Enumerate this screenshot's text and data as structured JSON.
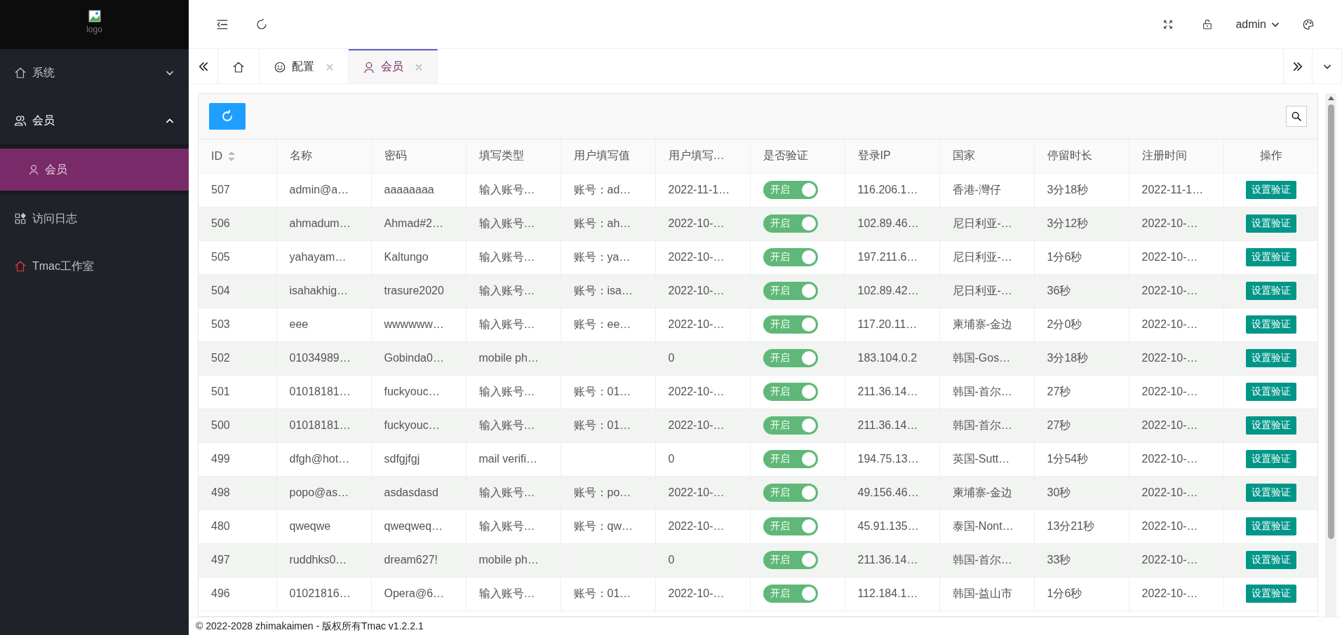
{
  "logo": {
    "alt": "logo"
  },
  "sidebar": {
    "items": [
      {
        "label": "系统",
        "expanded": false,
        "selected": false
      },
      {
        "label": "会员",
        "expanded": true,
        "selected": false,
        "children": [
          {
            "label": "会员",
            "selected": true
          }
        ]
      },
      {
        "label": "访问日志",
        "selected": false
      },
      {
        "label": "Tmac工作室",
        "selected": false
      }
    ]
  },
  "header": {
    "user": "admin"
  },
  "tabs": [
    {
      "kind": "home",
      "selected": false
    },
    {
      "kind": "page",
      "label": "配置",
      "selected": false
    },
    {
      "kind": "page",
      "label": "会员",
      "selected": true
    }
  ],
  "table": {
    "columns": [
      {
        "label": "ID"
      },
      {
        "label": "名称"
      },
      {
        "label": "密码"
      },
      {
        "label": "填写类型"
      },
      {
        "label": "用户填写值"
      },
      {
        "label": "用户填写…"
      },
      {
        "label": "是否验证"
      },
      {
        "label": "登录IP"
      },
      {
        "label": "国家"
      },
      {
        "label": "停留时长"
      },
      {
        "label": "注册时间"
      },
      {
        "label": "操作"
      }
    ],
    "rows": [
      {
        "id": "507",
        "name": "admin@a…",
        "password": "aaaaaaaa",
        "fill_type": "输入账号…",
        "fill_value": "账号：ad…",
        "column_6": "2022-11-1…",
        "verify": {
          "label": "开启",
          "on": true
        },
        "login_ip": "116.206.1…",
        "country": "香港-灣仔",
        "stay_time": "3分18秒",
        "register_time": "2022-11-1…",
        "action": "设置验证"
      },
      {
        "id": "506",
        "name": "ahmadum…",
        "password": "Ahmad#2…",
        "fill_type": "输入账号…",
        "fill_value": "账号：ah…",
        "column_6": "2022-10-…",
        "verify": {
          "label": "开启",
          "on": true
        },
        "login_ip": "102.89.46…",
        "country": "尼日利亚-…",
        "stay_time": "3分12秒",
        "register_time": "2022-10-…",
        "action": "设置验证"
      },
      {
        "id": "505",
        "name": "yahayam…",
        "password": "Kaltungo",
        "fill_type": "输入账号…",
        "fill_value": "账号：ya…",
        "column_6": "2022-10-…",
        "verify": {
          "label": "开启",
          "on": true
        },
        "login_ip": "197.211.6…",
        "country": "尼日利亚-…",
        "stay_time": "1分6秒",
        "register_time": "2022-10-…",
        "action": "设置验证"
      },
      {
        "id": "504",
        "name": "isahakhig…",
        "password": "trasure2020",
        "fill_type": "输入账号…",
        "fill_value": "账号：isa…",
        "column_6": "2022-10-…",
        "verify": {
          "label": "开启",
          "on": true
        },
        "login_ip": "102.89.42…",
        "country": "尼日利亚-…",
        "stay_time": "36秒",
        "register_time": "2022-10-…",
        "action": "设置验证"
      },
      {
        "id": "503",
        "name": "eee",
        "password": "wwwwww…",
        "fill_type": "输入账号…",
        "fill_value": "账号：ee…",
        "column_6": "2022-10-…",
        "verify": {
          "label": "开启",
          "on": true
        },
        "login_ip": "117.20.11…",
        "country": "柬埔寨-金边",
        "stay_time": "2分0秒",
        "register_time": "2022-10-…",
        "action": "设置验证"
      },
      {
        "id": "502",
        "name": "01034989…",
        "password": "Gobinda0…",
        "fill_type": "mobile ph…",
        "column_6": "0",
        "verify": {
          "label": "开启",
          "on": true
        },
        "login_ip": "183.104.0.2",
        "country": "韩国-Gos…",
        "stay_time": "3分18秒",
        "register_time": "2022-10-…",
        "action": "设置验证"
      },
      {
        "id": "501",
        "name": "01018181…",
        "password": "fuckyouc…",
        "fill_type": "输入账号…",
        "fill_value": "账号：01…",
        "column_6": "2022-10-…",
        "verify": {
          "label": "开启",
          "on": true
        },
        "login_ip": "211.36.14…",
        "country": "韩国-首尔…",
        "stay_time": "27秒",
        "register_time": "2022-10-…",
        "action": "设置验证"
      },
      {
        "id": "500",
        "name": "01018181…",
        "password": "fuckyouc…",
        "fill_type": "输入账号…",
        "fill_value": "账号：01…",
        "column_6": "2022-10-…",
        "verify": {
          "label": "开启",
          "on": true
        },
        "login_ip": "211.36.14…",
        "country": "韩国-首尔…",
        "stay_time": "27秒",
        "register_time": "2022-10-…",
        "action": "设置验证"
      },
      {
        "id": "499",
        "name": "dfgh@hot…",
        "password": "sdfgjfgj",
        "fill_type": "mail verifi…",
        "column_6": "0",
        "verify": {
          "label": "开启",
          "on": true
        },
        "login_ip": "194.75.13…",
        "country": "英国-Sutt…",
        "stay_time": "1分54秒",
        "register_time": "2022-10-…",
        "action": "设置验证"
      },
      {
        "id": "498",
        "name": "popo@as…",
        "password": "asdasdasd",
        "fill_type": "输入账号…",
        "fill_value": "账号：po…",
        "column_6": "2022-10-…",
        "verify": {
          "label": "开启",
          "on": true
        },
        "login_ip": "49.156.46…",
        "country": "柬埔寨-金边",
        "stay_time": "30秒",
        "register_time": "2022-10-…",
        "action": "设置验证"
      },
      {
        "id": "480",
        "name": "qweqwe",
        "password": "qweqweq…",
        "fill_type": "输入账号…",
        "fill_value": "账号：qw…",
        "column_6": "2022-10-…",
        "verify": {
          "label": "开启",
          "on": true
        },
        "login_ip": "45.91.135…",
        "country": "泰国-Nont…",
        "stay_time": "13分21秒",
        "register_time": "2022-10-…",
        "action": "设置验证"
      },
      {
        "id": "497",
        "name": "ruddhks0…",
        "password": "dream627!",
        "fill_type": "mobile ph…",
        "column_6": "0",
        "verify": {
          "label": "开启",
          "on": true
        },
        "login_ip": "211.36.14…",
        "country": "韩国-首尔…",
        "stay_time": "33秒",
        "register_time": "2022-10-…",
        "action": "设置验证"
      },
      {
        "id": "496",
        "name": "01021816…",
        "password": "Opera@6…",
        "fill_type": "输入账号…",
        "fill_value": "账号：01…",
        "column_6": "2022-10-…",
        "verify": {
          "label": "开启",
          "on": true
        },
        "login_ip": "112.184.1…",
        "country": "韩国-益山市",
        "stay_time": "1分6秒",
        "register_time": "2022-10-…",
        "action": "设置验证"
      }
    ]
  },
  "footer": {
    "text": "© 2022-2028 zhimakaimen - 版权所有Tmac v1.2.2.1"
  }
}
